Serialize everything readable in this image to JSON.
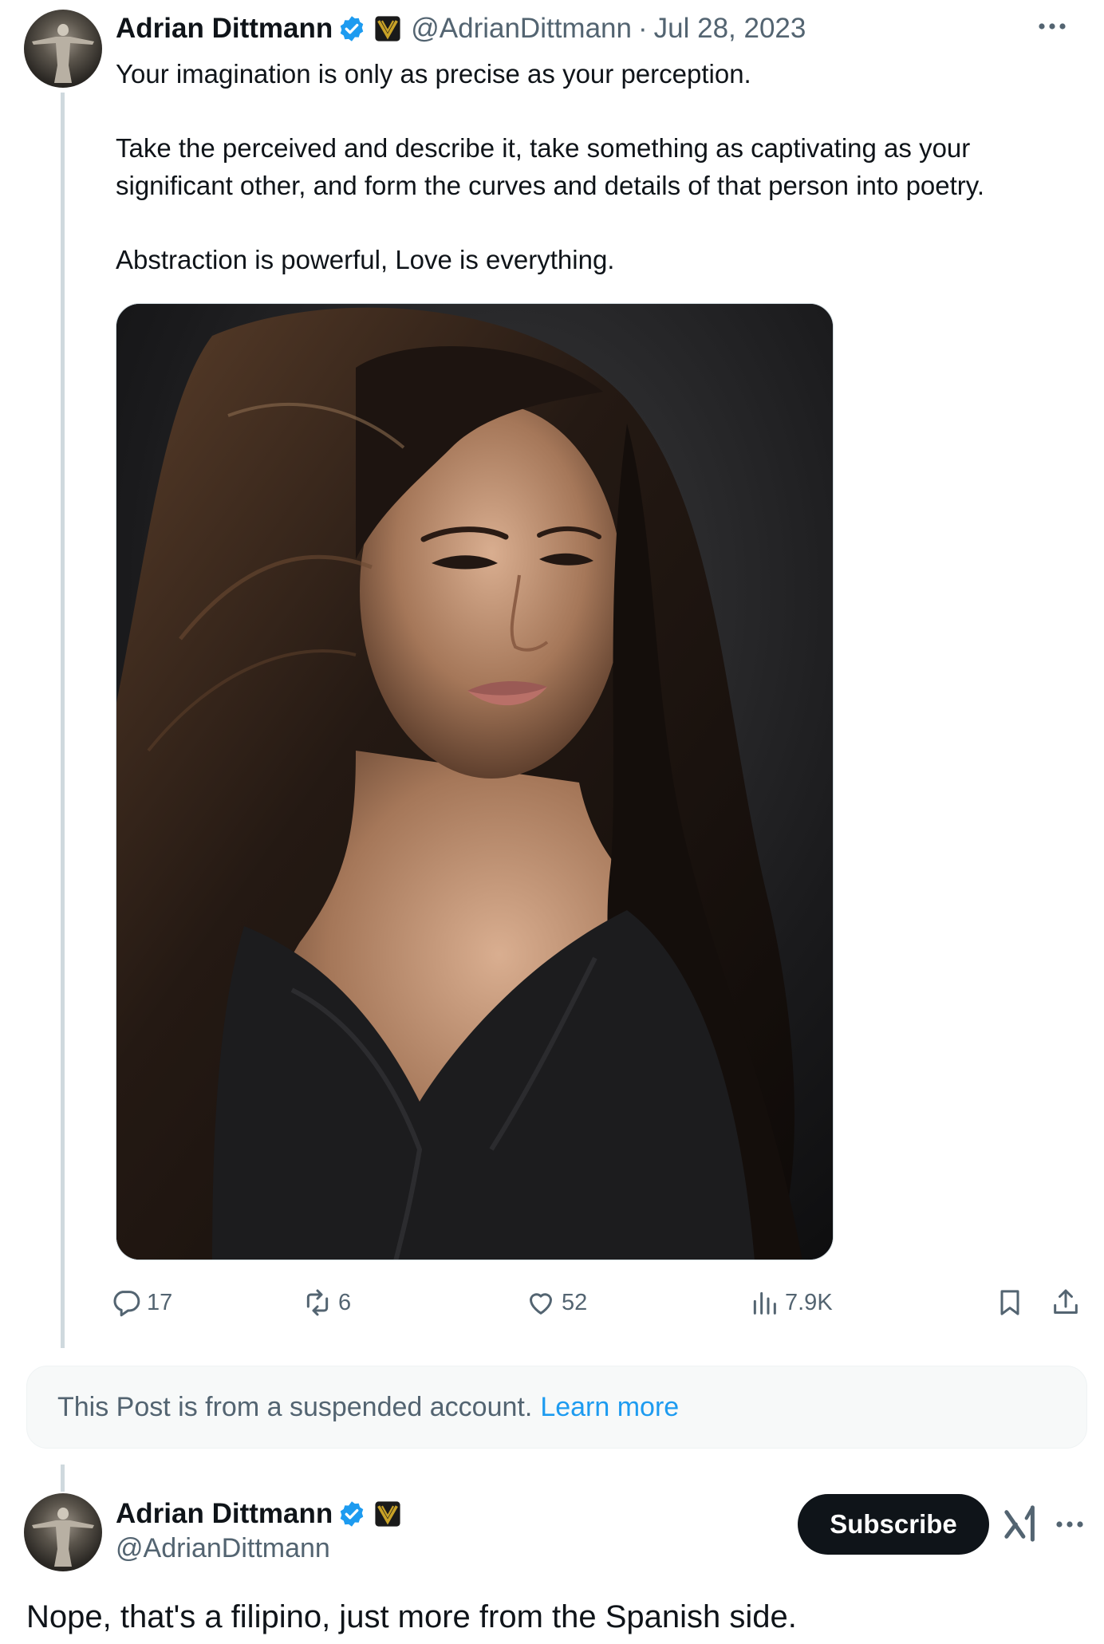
{
  "post": {
    "author_name": "Adrian Dittmann",
    "handle": "@AdrianDittmann",
    "separator": "·",
    "date": "Jul 28, 2023",
    "verified_icon": "verified-badge-icon",
    "affiliate_icon": "affiliate-badge-icon",
    "text_paragraphs": [
      "Your imagination is only as precise as your perception.",
      "Take the perceived and describe it, take something as captivating as your significant other, and form the curves and details of that person into poetry.",
      "Abstraction is powerful, Love is everything."
    ],
    "media_icon": "portrait-photo",
    "stats": {
      "replies": "17",
      "reposts": "6",
      "likes": "52",
      "views": "7.9K"
    }
  },
  "notice": {
    "text": "This Post is from a suspended account.",
    "link": "Learn more"
  },
  "reply": {
    "author_name": "Adrian Dittmann",
    "handle": "@AdrianDittmann",
    "subscribe_label": "Subscribe",
    "text": "Nope, that's a filipino, just more from the Spanish side."
  },
  "colors": {
    "accent": "#1d9bf0",
    "text_primary": "#0f1419",
    "text_secondary": "#536471",
    "affiliate_gold": "#c9a227"
  }
}
